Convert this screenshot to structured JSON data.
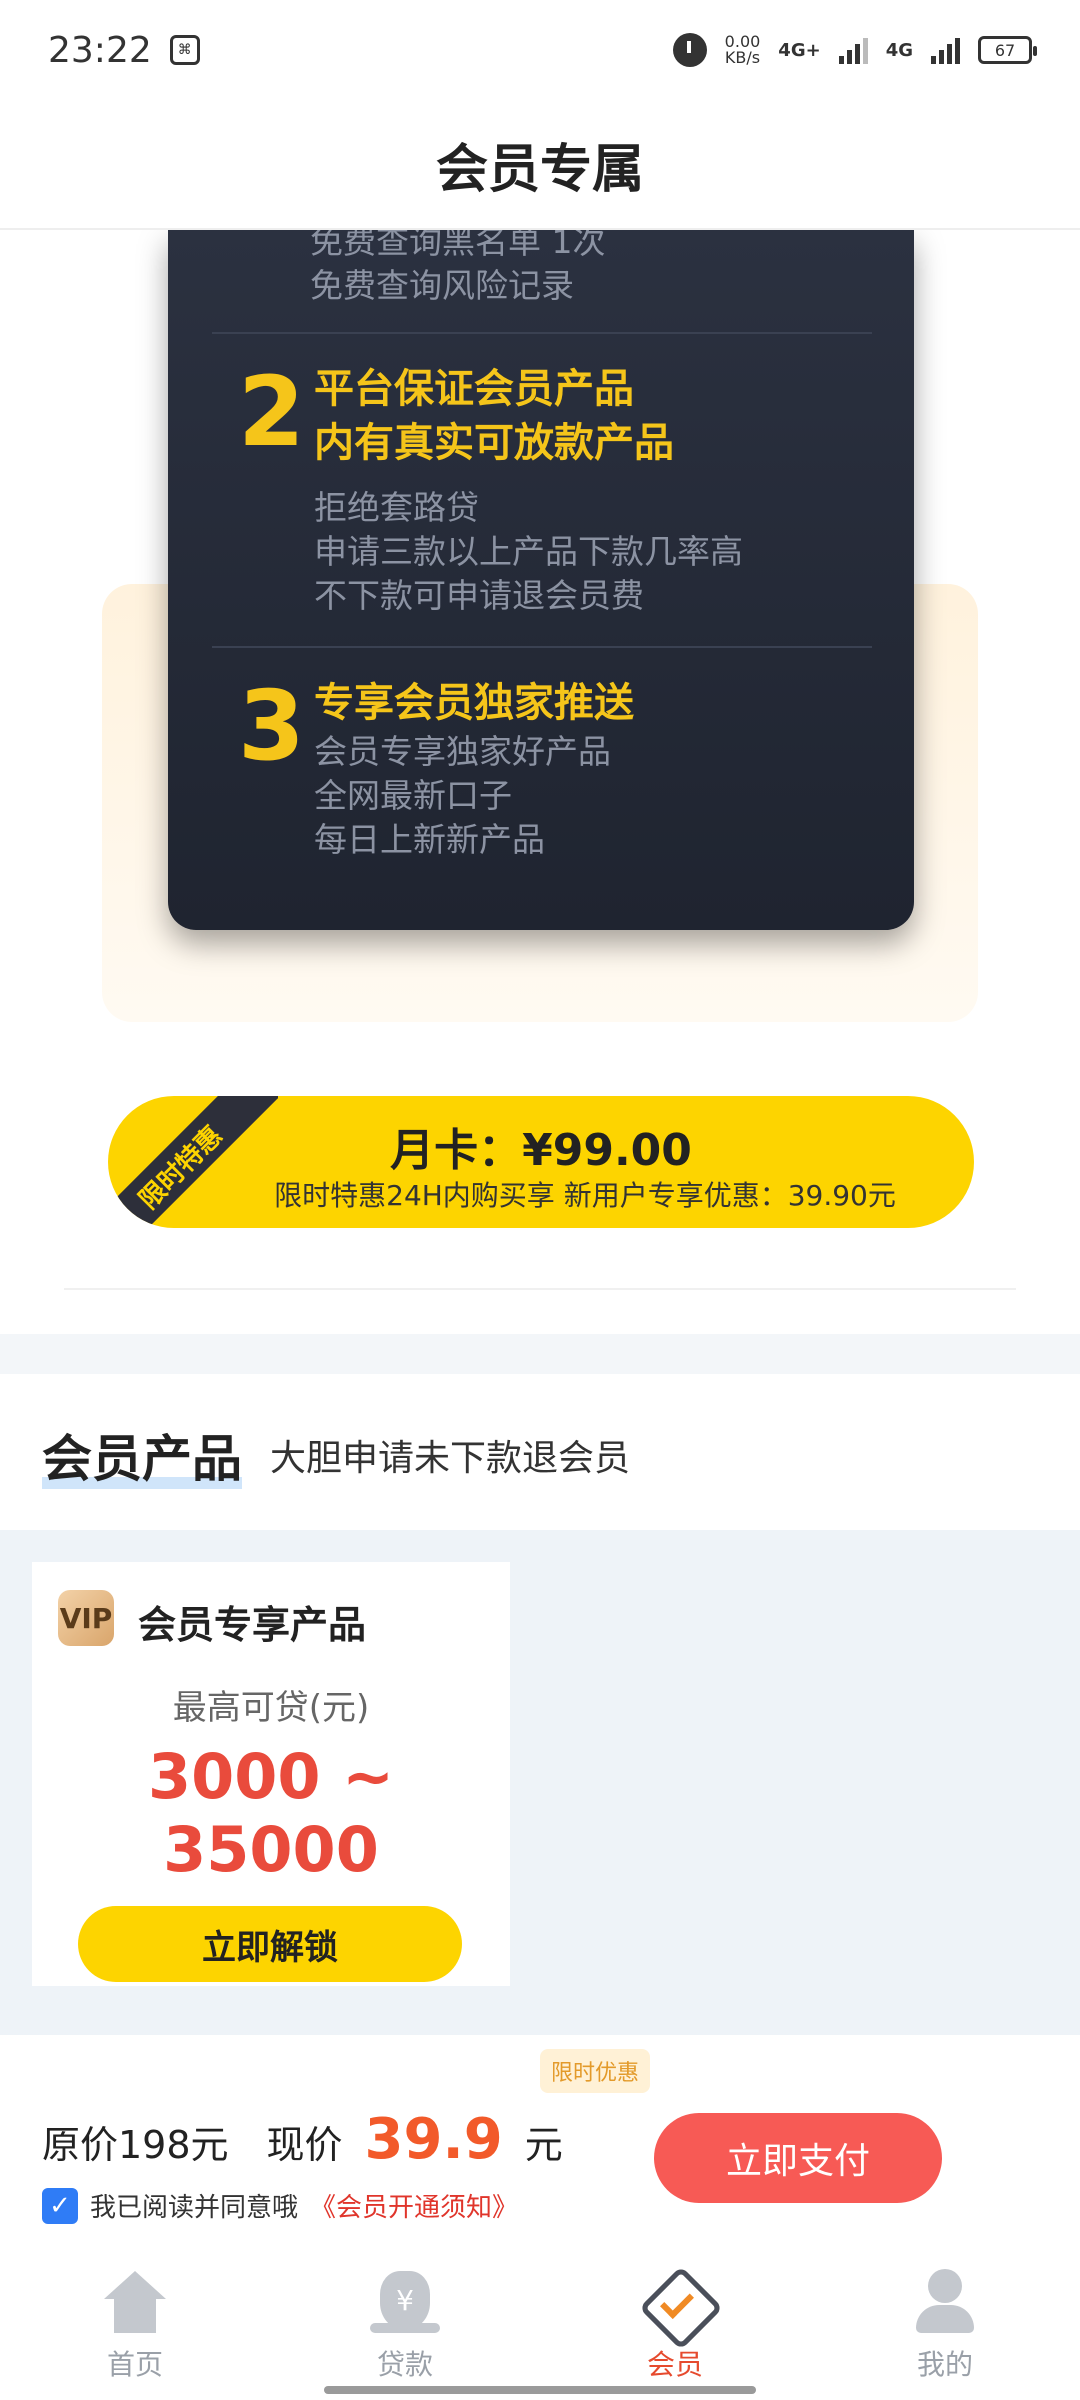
{
  "status_bar": {
    "time": "23:22",
    "net_speed_value": "0.00",
    "net_speed_unit": "KB/s",
    "sig1_label": "4G+",
    "sig2_label": "4G",
    "battery": "67"
  },
  "header": {
    "title": "会员专属"
  },
  "benefits": {
    "top_lines": [
      "免费查询黑名单 1次",
      "免费查询风险记录"
    ],
    "items": [
      {
        "number": "2",
        "head_lines": [
          "平台保证会员产品",
          "内有真实可放款产品"
        ],
        "desc_lines": [
          "拒绝套路贷",
          "申请三款以上产品下款几率高",
          "不下款可申请退会员费"
        ]
      },
      {
        "number": "3",
        "head_lines": [
          "专享会员独家推送"
        ],
        "desc_lines": [
          "会员专享独家好产品",
          "全网最新口子",
          "每日上新新产品"
        ]
      }
    ]
  },
  "price_pill": {
    "ribbon": "限时特惠",
    "main": "月卡：¥99.00",
    "sub": "限时特惠24H内购买享    新用户专享优惠：39.90元"
  },
  "section": {
    "title": "会员产品",
    "desc": "大胆申请未下款退会员"
  },
  "product": {
    "logo_text": "VIP",
    "name": "会员专享产品",
    "loan_label": "最高可贷(元)",
    "loan_range": "3000 ~ 35000",
    "button": "立即解锁"
  },
  "payment": {
    "badge": "限时优惠",
    "orig_price": "原价198元",
    "now_label": "现价",
    "now_price": "39.9",
    "unit": "元",
    "pay_button": "立即支付",
    "agree_text": "我已阅读并同意哦",
    "agree_link": "《会员开通须知》",
    "checked": true
  },
  "nav": {
    "items": [
      {
        "label": "首页",
        "icon": "home-icon"
      },
      {
        "label": "贷款",
        "icon": "loan-bag-icon"
      },
      {
        "label": "会员",
        "icon": "vip-diamond-icon"
      },
      {
        "label": "我的",
        "icon": "profile-icon"
      }
    ],
    "active_index": 2
  },
  "colors": {
    "accent_yellow": "#fdd400",
    "gold_text": "#f5c51a",
    "dark_card": "#2b3140",
    "price_red": "#e94b3c",
    "pay_button": "#f75a55",
    "nav_active": "#e64a2e"
  }
}
